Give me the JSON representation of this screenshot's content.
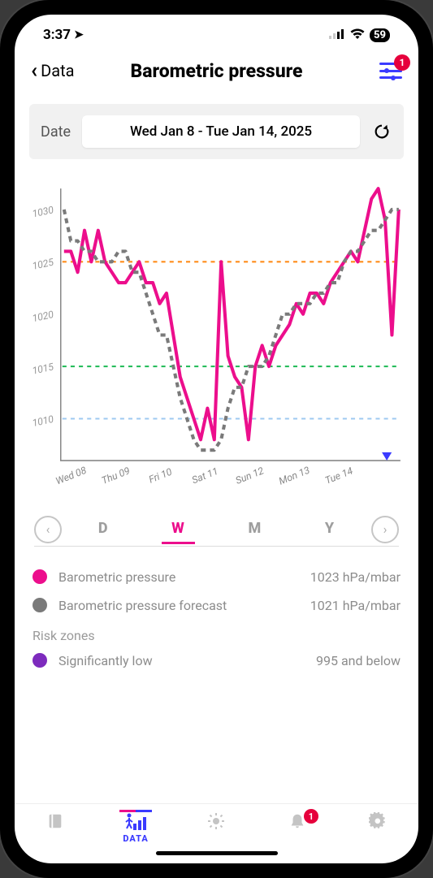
{
  "status": {
    "time": "3:37",
    "battery": "59"
  },
  "header": {
    "back_label": "Data",
    "title": "Barometric pressure",
    "filter_badge": "1"
  },
  "date_picker": {
    "label": "Date",
    "value": "Wed Jan 8 - Tue Jan 14, 2025"
  },
  "range_tabs": {
    "d": "D",
    "w": "W",
    "m": "M",
    "y": "Y",
    "active": "W"
  },
  "legend": {
    "pressure": {
      "label": "Barometric pressure",
      "value": "1023 hPa/mbar",
      "color": "#ec0e8c"
    },
    "forecast": {
      "label": "Barometric pressure forecast",
      "value": "1021 hPa/mbar",
      "color": "#7a7a7a"
    },
    "risk_head": "Risk zones",
    "sig_low": {
      "label": "Significantly low",
      "value": "995 and below",
      "color": "#7d2bbd"
    }
  },
  "tabbar": {
    "active": "DATA",
    "data_label": "DATA",
    "alerts_badge": "1"
  },
  "chart_data": {
    "type": "line",
    "title": "Barometric pressure",
    "ylabel": "hPa/mbar",
    "ylim": [
      1006,
      1032
    ],
    "y_ticks": [
      1010,
      1015,
      1020,
      1025,
      1030
    ],
    "categories": [
      "Wed 08",
      "Thu 09",
      "Fri 10",
      "Sat 11",
      "Sun 12",
      "Mon 13",
      "Tue 14"
    ],
    "thresholds": [
      {
        "name": "high",
        "value": 1025,
        "color": "#ff8c1a"
      },
      {
        "name": "mid",
        "value": 1015,
        "color": "#1db954"
      },
      {
        "name": "low",
        "value": 1010,
        "color": "#9ec9f0"
      }
    ],
    "series": [
      {
        "name": "Barometric pressure",
        "color": "#ec0e8c",
        "values": [
          1026,
          1026,
          1024,
          1028,
          1025,
          1028,
          1025,
          1024,
          1023,
          1023,
          1024,
          1025,
          1023,
          1023,
          1021,
          1022,
          1018,
          1014,
          1012,
          1010,
          1008,
          1011,
          1008,
          1025,
          1016,
          1014,
          1013,
          1008,
          1015,
          1017,
          1015,
          1017,
          1018,
          1019,
          1021,
          1020,
          1022,
          1022,
          1021,
          1023,
          1024,
          1025,
          1026,
          1025,
          1028,
          1031,
          1032,
          1029,
          1018,
          1030
        ]
      },
      {
        "name": "Barometric pressure forecast",
        "color": "#7a7a7a",
        "style": "dashed",
        "values": [
          1030,
          1027,
          1027,
          1026,
          1026,
          1025,
          1025,
          1025,
          1026,
          1026,
          1024,
          1024,
          1022,
          1020,
          1018,
          1018,
          1015,
          1012,
          1010,
          1008,
          1007,
          1007,
          1007,
          1008,
          1011,
          1013,
          1013,
          1015,
          1015,
          1015,
          1016,
          1018,
          1020,
          1020,
          1021,
          1021,
          1021,
          1022,
          1022,
          1023,
          1023,
          1025,
          1026,
          1026,
          1027,
          1028,
          1028,
          1029,
          1030,
          1030
        ]
      }
    ]
  }
}
